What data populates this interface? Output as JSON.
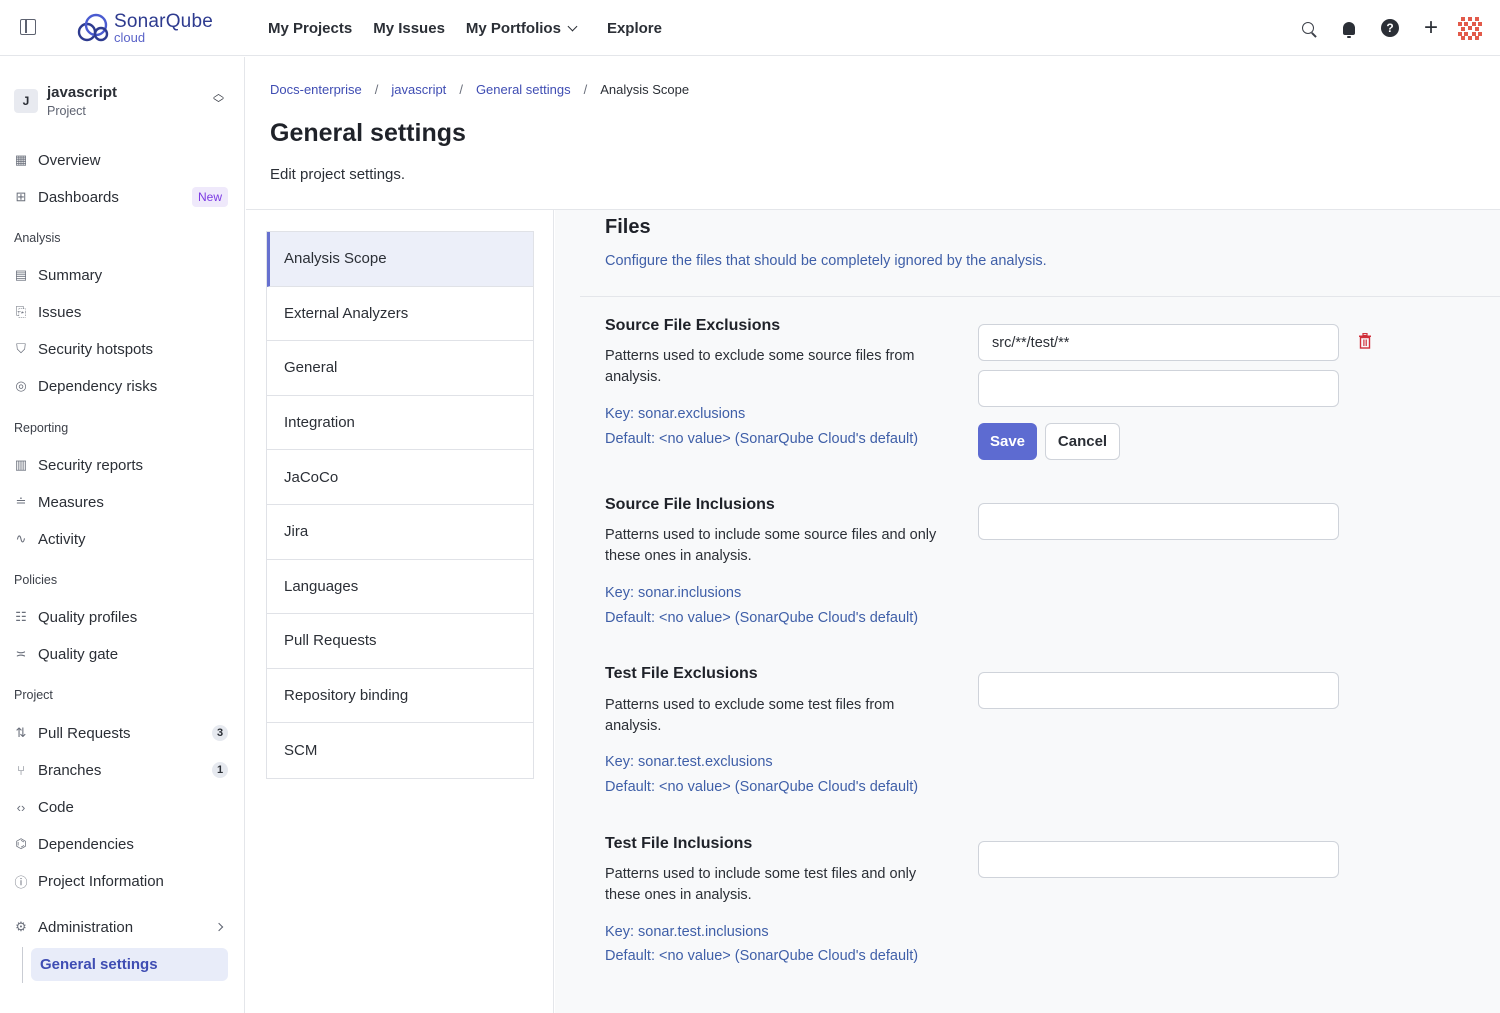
{
  "brand": {
    "name": "SonarQube",
    "sub": "cloud"
  },
  "topnav": [
    {
      "label": "My Projects"
    },
    {
      "label": "My Issues"
    },
    {
      "label": "My Portfolios"
    },
    {
      "label": "Explore"
    }
  ],
  "project": {
    "avatar": "J",
    "name": "javascript",
    "type": "Project"
  },
  "sidebar": {
    "overview": "Overview",
    "dashboards": "Dashboards",
    "dashboards_badge": "New",
    "group_analysis": "Analysis",
    "summary": "Summary",
    "issues": "Issues",
    "security_hotspots": "Security hotspots",
    "dependency_risks": "Dependency risks",
    "group_reporting": "Reporting",
    "security_reports": "Security reports",
    "measures": "Measures",
    "activity": "Activity",
    "group_policies": "Policies",
    "quality_profiles": "Quality profiles",
    "quality_gate": "Quality gate",
    "group_project": "Project",
    "pull_requests": "Pull Requests",
    "pull_requests_count": "3",
    "branches": "Branches",
    "branches_count": "1",
    "code": "Code",
    "dependencies": "Dependencies",
    "project_information": "Project Information",
    "administration": "Administration",
    "general_settings": "General settings"
  },
  "breadcrumb": [
    "Docs-enterprise",
    "javascript",
    "General settings",
    "Analysis Scope"
  ],
  "page": {
    "title": "General settings",
    "subtitle": "Edit project settings."
  },
  "categories": [
    "Analysis Scope",
    "External Analyzers",
    "General",
    "Integration",
    "JaCoCo",
    "Jira",
    "Languages",
    "Pull Requests",
    "Repository binding",
    "SCM"
  ],
  "section": {
    "title": "Files",
    "description": "Configure the files that should be completely ignored by the analysis."
  },
  "definitions": [
    {
      "title": "Source File Exclusions",
      "description": "Patterns used to exclude some source files from analysis.",
      "key": "Key: sonar.exclusions",
      "default": "Default: <no value> (SonarQube Cloud's default)",
      "values": [
        "src/**/test/**",
        ""
      ]
    },
    {
      "title": "Source File Inclusions",
      "description": "Patterns used to include some source files and only these ones in analysis.",
      "key": "Key: sonar.inclusions",
      "default": "Default: <no value> (SonarQube Cloud's default)",
      "values": [
        ""
      ]
    },
    {
      "title": "Test File Exclusions",
      "description": "Patterns used to exclude some test files from analysis.",
      "key": "Key: sonar.test.exclusions",
      "default": "Default: <no value> (SonarQube Cloud's default)",
      "values": [
        ""
      ]
    },
    {
      "title": "Test File Inclusions",
      "description": "Patterns used to include some test files and only these ones in analysis.",
      "key": "Key: sonar.test.inclusions",
      "default": "Default: <no value> (SonarQube Cloud's default)",
      "values": [
        ""
      ]
    }
  ],
  "buttons": {
    "save": "Save",
    "cancel": "Cancel"
  },
  "colors": {
    "accent": "#5d6bd1",
    "link": "#3f4db3",
    "danger": "#d02f3a"
  }
}
